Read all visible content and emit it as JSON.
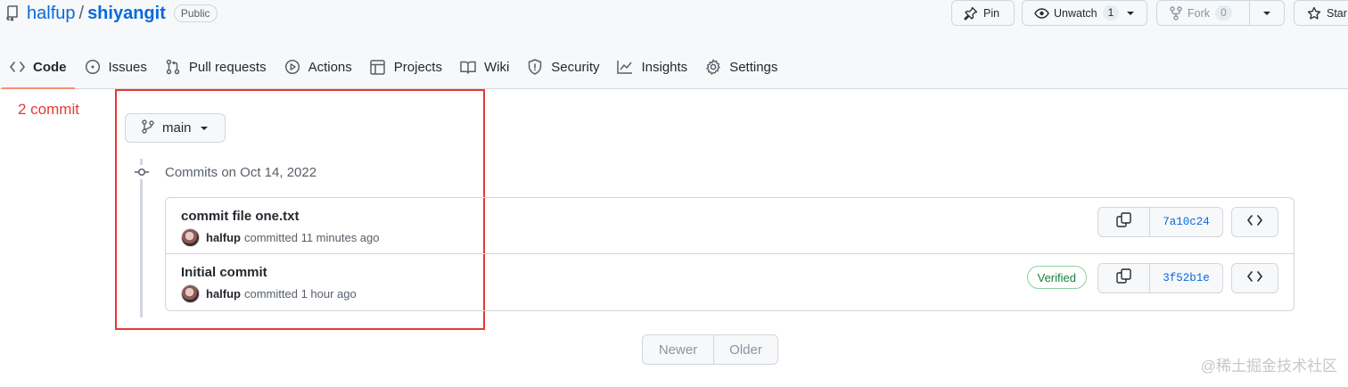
{
  "repo": {
    "owner": "halfup",
    "separator": "/",
    "name": "shiyangit",
    "visibility": "Public"
  },
  "actions": {
    "pin_label": "Pin",
    "watch_label": "Unwatch",
    "watch_count": "1",
    "fork_label": "Fork",
    "fork_count": "0",
    "star_label": "Star"
  },
  "tabs": [
    {
      "label": "Code",
      "icon": "code-icon",
      "active": true
    },
    {
      "label": "Issues",
      "icon": "issue-icon"
    },
    {
      "label": "Pull requests",
      "icon": "pull-request-icon"
    },
    {
      "label": "Actions",
      "icon": "play-icon"
    },
    {
      "label": "Projects",
      "icon": "table-icon"
    },
    {
      "label": "Wiki",
      "icon": "book-icon"
    },
    {
      "label": "Security",
      "icon": "shield-icon"
    },
    {
      "label": "Insights",
      "icon": "graph-icon"
    },
    {
      "label": "Settings",
      "icon": "gear-icon"
    }
  ],
  "annotation": {
    "label": "2 commit",
    "color": "#e53935"
  },
  "branch": {
    "name": "main"
  },
  "commit_group": {
    "title": "Commits on Oct 14, 2022"
  },
  "commits": [
    {
      "message": "commit file one.txt",
      "author": "halfup",
      "time": "committed 11 minutes ago",
      "sha": "7a10c24",
      "verified": ""
    },
    {
      "message": "Initial commit",
      "author": "halfup",
      "time": "committed 1 hour ago",
      "sha": "3f52b1e",
      "verified": "Verified"
    }
  ],
  "pagination": {
    "newer": "Newer",
    "older": "Older"
  },
  "watermark": "@稀土掘金技术社区",
  "colors": {
    "link": "#0969da",
    "active_tab_underline": "#fd8c73",
    "verified": "#1a7f37"
  }
}
